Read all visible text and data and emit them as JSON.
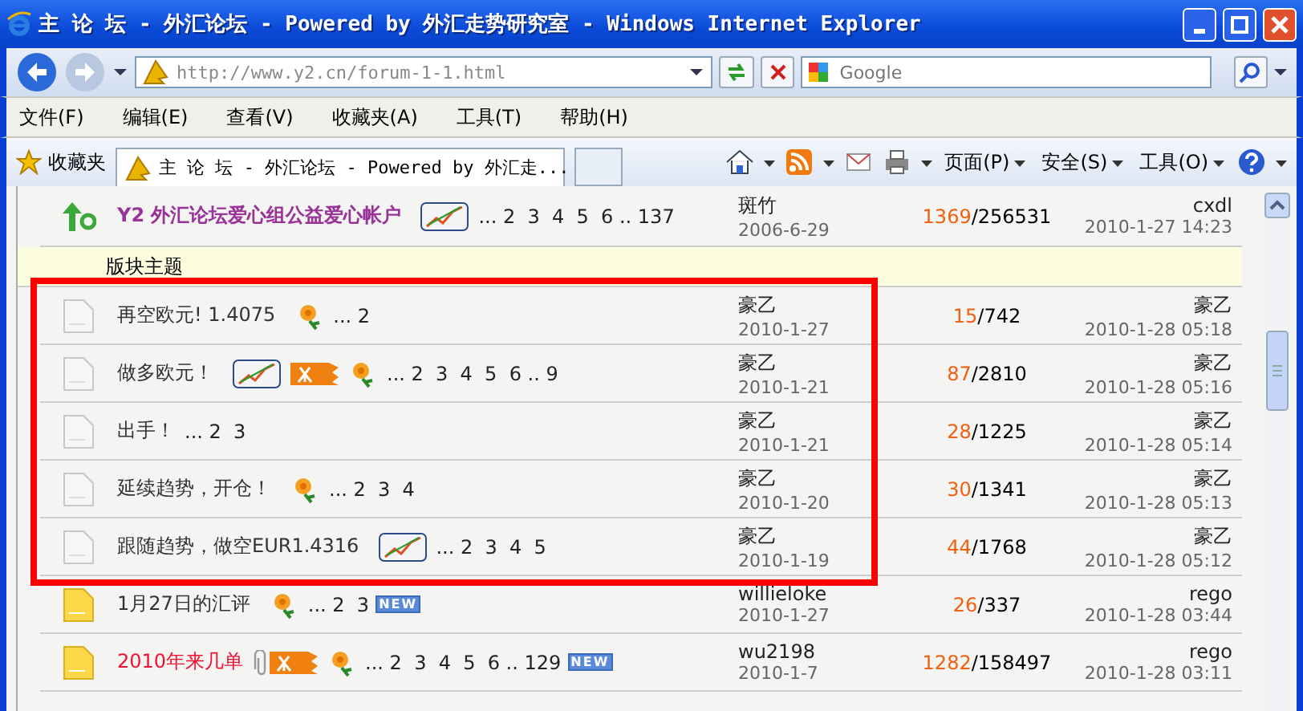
{
  "window": {
    "title": "主 论 坛 - 外汇论坛 - Powered by 外汇走势研究室 - Windows Internet Explorer"
  },
  "address_bar": {
    "url": "http://www.y2.cn/forum-1-1.html",
    "search_placeholder": "Google"
  },
  "menu": [
    "文件(F)",
    "编辑(E)",
    "查看(V)",
    "收藏夹(A)",
    "工具(T)",
    "帮助(H)"
  ],
  "command_bar": {
    "favorites": "收藏夹",
    "tab_title": "主 论 坛 - 外汇论坛 - Powered by 外汇走...",
    "commands": [
      "页面(P)",
      "安全(S)",
      "工具(O)"
    ]
  },
  "forum": {
    "section_header": "版块主题",
    "rows": [
      {
        "kind": "sticky",
        "highlighted": false,
        "title": "Y2 外汇论坛爱心组公益爱心帐户",
        "color": "#993399",
        "markers": [
          {
            "kind": "chart"
          }
        ],
        "pages": "... 2  3  4  5  6 .. 137",
        "author": "斑竹",
        "date": "2006-6-29",
        "replies": "1369",
        "views": "/256531",
        "last_author": "cxdl",
        "last_time": "2010-1-27 14:23"
      },
      {
        "kind": "topic",
        "unread": false,
        "highlighted": true,
        "title": "再空欧元! 1.4075",
        "color": "#333333",
        "markers": [
          {
            "kind": "flower"
          }
        ],
        "pages": "... 2",
        "author": "豪乙",
        "date": "2010-1-27",
        "replies": "15",
        "views": "/742",
        "last_author": "豪乙",
        "last_time": "2010-1-28 05:18"
      },
      {
        "kind": "topic",
        "unread": false,
        "highlighted": true,
        "title": "做多欧元！",
        "color": "#333333",
        "markers": [
          {
            "kind": "chart"
          },
          {
            "kind": "hot"
          },
          {
            "kind": "flower"
          }
        ],
        "pages": "... 2  3  4  5  6 .. 9",
        "author": "豪乙",
        "date": "2010-1-21",
        "replies": "87",
        "views": "/2810",
        "last_author": "豪乙",
        "last_time": "2010-1-28 05:16"
      },
      {
        "kind": "topic",
        "unread": false,
        "highlighted": true,
        "title": "出手！",
        "color": "#333333",
        "markers": [],
        "pages": "... 2  3",
        "author": "豪乙",
        "date": "2010-1-21",
        "replies": "28",
        "views": "/1225",
        "last_author": "豪乙",
        "last_time": "2010-1-28 05:14"
      },
      {
        "kind": "topic",
        "unread": false,
        "highlighted": true,
        "title": "延续趋势，开仓！",
        "color": "#333333",
        "markers": [
          {
            "kind": "flower"
          }
        ],
        "pages": "... 2  3  4",
        "author": "豪乙",
        "date": "2010-1-20",
        "replies": "30",
        "views": "/1341",
        "last_author": "豪乙",
        "last_time": "2010-1-28 05:13"
      },
      {
        "kind": "topic",
        "unread": false,
        "highlighted": true,
        "title": "跟随趋势，做空EUR1.4316",
        "color": "#333333",
        "markers": [
          {
            "kind": "chart"
          }
        ],
        "pages": "... 2  3  4  5",
        "author": "豪乙",
        "date": "2010-1-19",
        "replies": "44",
        "views": "/1768",
        "last_author": "豪乙",
        "last_time": "2010-1-28 05:12"
      },
      {
        "kind": "topic",
        "unread": true,
        "highlighted": false,
        "title": "1月27日的汇评",
        "color": "#333333",
        "markers": [
          {
            "kind": "flower"
          }
        ],
        "pages": "... 2  3",
        "new_badge": "NEW",
        "author": "willieloke",
        "date": "2010-1-27",
        "replies": "26",
        "views": "/337",
        "last_author": "rego",
        "last_time": "2010-1-28 03:44"
      },
      {
        "kind": "topic",
        "unread": true,
        "highlighted": false,
        "title": "2010年来几单",
        "color": "#ee1133",
        "markers": [
          {
            "kind": "attachment"
          },
          {
            "kind": "hot"
          },
          {
            "kind": "flower"
          }
        ],
        "pages": "... 2  3  4  5  6 .. 129",
        "new_badge": "NEW",
        "author": "wu2198",
        "date": "2010-1-7",
        "replies": "1282",
        "views": "/158497",
        "last_author": "rego",
        "last_time": "2010-1-28 03:11"
      }
    ]
  }
}
